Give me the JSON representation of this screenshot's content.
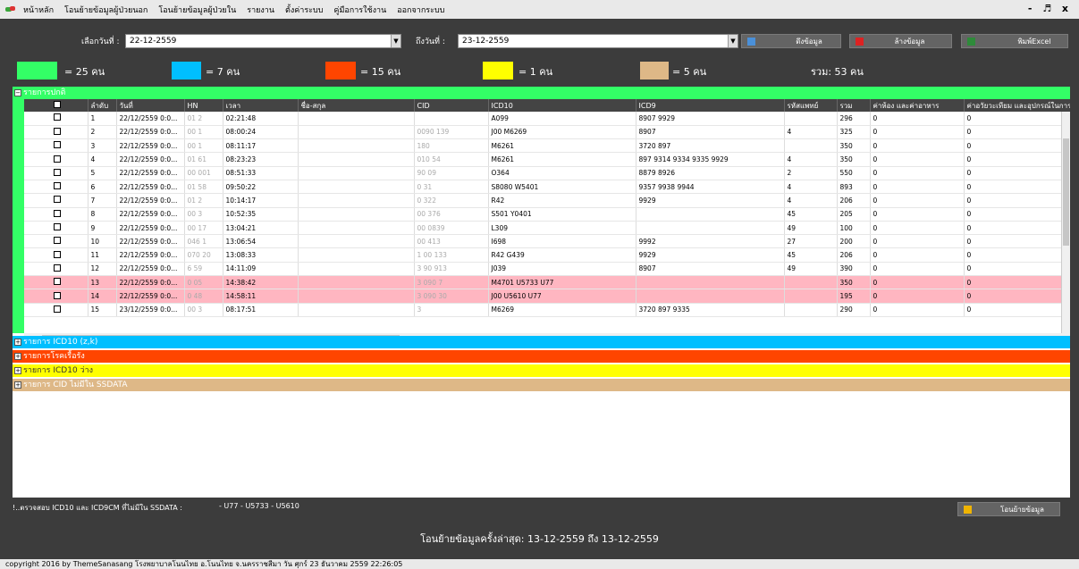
{
  "menu": {
    "items": [
      "หน้าหลัก",
      "โอนย้ายข้อมูลผู้ป่วยนอก",
      "โอนย้ายข้อมูลผู้ป่วยใน",
      "รายงาน",
      "ตั้งค่าระบบ",
      "คู่มือการใช้งาน",
      "ออกจากระบบ"
    ],
    "window_controls": "- ♬ x"
  },
  "filter": {
    "from_label": "เลือกวันที่ :",
    "from_value": "22-12-2559",
    "to_label": "ถึงวันที่ :",
    "to_value": "23-12-2559",
    "fetch_button": "ดึงข้อมูล",
    "clear_button": "ล้างข้อมูล",
    "excel_button": "พิมพ์Excel"
  },
  "legend": [
    {
      "color": "#33ff66",
      "text": "= 25 คน"
    },
    {
      "color": "#00bfff",
      "text": "= 7 คน"
    },
    {
      "color": "#ff4500",
      "text": "= 15 คน"
    },
    {
      "color": "#ffff00",
      "text": "= 1 คน"
    },
    {
      "color": "#deb887",
      "text": "= 5 คน"
    }
  ],
  "total_text": "รวม: 53 คน",
  "groups": {
    "normal": "รายการปกติ",
    "icd10_zk": "รายการ ICD10 (z,k)",
    "chronic": "รายการโรคเรื้อรัง",
    "icd10_empty": "รายการ ICD10 ว่าง",
    "cid_missing": "รายการ CID ไม่มีใน SSDATA"
  },
  "table": {
    "columns": [
      "",
      "ลำดับ",
      "วันที่",
      "HN",
      "เวลา",
      "ชื่อ-สกุล",
      "CID",
      "ICD10",
      "ICD9",
      "รหัสแพทย์",
      "รวม",
      "ค่าห้อง และค่าอาหาร",
      "ค่าอวัยวะเทียม และอุปกรณ์ในการบำบัด"
    ],
    "rows": [
      {
        "no": "1",
        "date": "22/12/2559 0:0...",
        "hn": "01 2",
        "time": "02:21:48",
        "name": "",
        "cid": "",
        "icd10": "A099",
        "icd9": "8907 9929",
        "doc": "",
        "total": "296",
        "room": "0",
        "device": "0",
        "pink": false
      },
      {
        "no": "2",
        "date": "22/12/2559 0:0...",
        "hn": "00 1",
        "time": "08:00:24",
        "name": "",
        "cid": "0090 139",
        "icd10": "J00 M6269",
        "icd9": "8907",
        "doc": "4",
        "total": "325",
        "room": "0",
        "device": "0",
        "pink": false
      },
      {
        "no": "3",
        "date": "22/12/2559 0:0...",
        "hn": "00 1",
        "time": "08:11:17",
        "name": "",
        "cid": "180",
        "icd10": "M6261",
        "icd9": "3720 897",
        "doc": "",
        "total": "350",
        "room": "0",
        "device": "0",
        "pink": false
      },
      {
        "no": "4",
        "date": "22/12/2559 0:0...",
        "hn": "01 61",
        "time": "08:23:23",
        "name": "",
        "cid": "010 54",
        "icd10": "M6261",
        "icd9": "897 9314 9334 9335 9929",
        "doc": "4",
        "total": "350",
        "room": "0",
        "device": "0",
        "pink": false
      },
      {
        "no": "5",
        "date": "22/12/2559 0:0...",
        "hn": "00 001",
        "time": "08:51:33",
        "name": "",
        "cid": "90 09",
        "icd10": "O364",
        "icd9": "8879 8926",
        "doc": "2",
        "total": "550",
        "room": "0",
        "device": "0",
        "pink": false
      },
      {
        "no": "6",
        "date": "22/12/2559 0:0...",
        "hn": "01 58",
        "time": "09:50:22",
        "name": "",
        "cid": "0 31",
        "icd10": "S8080 W5401",
        "icd9": "9357 9938 9944",
        "doc": "4",
        "total": "893",
        "room": "0",
        "device": "0",
        "pink": false
      },
      {
        "no": "7",
        "date": "22/12/2559 0:0...",
        "hn": "01 2",
        "time": "10:14:17",
        "name": "",
        "cid": "0 322",
        "icd10": "R42",
        "icd9": "9929",
        "doc": "4",
        "total": "206",
        "room": "0",
        "device": "0",
        "pink": false
      },
      {
        "no": "8",
        "date": "22/12/2559 0:0...",
        "hn": "00 3",
        "time": "10:52:35",
        "name": "",
        "cid": "00 376",
        "icd10": "S501 Y0401",
        "icd9": "",
        "doc": "45",
        "total": "205",
        "room": "0",
        "device": "0",
        "pink": false
      },
      {
        "no": "9",
        "date": "22/12/2559 0:0...",
        "hn": "00 17",
        "time": "13:04:21",
        "name": "",
        "cid": "00 0839",
        "icd10": "L309",
        "icd9": "",
        "doc": "49",
        "total": "100",
        "room": "0",
        "device": "0",
        "pink": false
      },
      {
        "no": "10",
        "date": "22/12/2559 0:0...",
        "hn": "046 1",
        "time": "13:06:54",
        "name": "",
        "cid": "00 413",
        "icd10": "I698",
        "icd9": "9992",
        "doc": "27",
        "total": "200",
        "room": "0",
        "device": "0",
        "pink": false
      },
      {
        "no": "11",
        "date": "22/12/2559 0:0...",
        "hn": "070 20",
        "time": "13:08:33",
        "name": "",
        "cid": "1 00 133",
        "icd10": "R42 G439",
        "icd9": "9929",
        "doc": "45",
        "total": "206",
        "room": "0",
        "device": "0",
        "pink": false
      },
      {
        "no": "12",
        "date": "22/12/2559 0:0...",
        "hn": "6 59",
        "time": "14:11:09",
        "name": "",
        "cid": "3 90 913",
        "icd10": "J039",
        "icd9": "8907",
        "doc": "49",
        "total": "390",
        "room": "0",
        "device": "0",
        "pink": false
      },
      {
        "no": "13",
        "date": "22/12/2559 0:0...",
        "hn": "0 05",
        "time": "14:38:42",
        "name": "",
        "cid": "3 090 7",
        "icd10": "M4701 U5733 U77",
        "icd9": "",
        "doc": "",
        "total": "350",
        "room": "0",
        "device": "0",
        "pink": true
      },
      {
        "no": "14",
        "date": "22/12/2559 0:0...",
        "hn": "0 48",
        "time": "14:58:11",
        "name": "",
        "cid": "3 090 30",
        "icd10": "J00 U5610 U77",
        "icd9": "",
        "doc": "",
        "total": "195",
        "room": "0",
        "device": "0",
        "pink": true
      },
      {
        "no": "15",
        "date": "23/12/2559 0:0...",
        "hn": "00 3",
        "time": "08:17:51",
        "name": "",
        "cid": "3",
        "icd10": "M6269",
        "icd9": "3720 897 9335",
        "doc": "",
        "total": "290",
        "room": "0",
        "device": "0",
        "pink": false
      }
    ]
  },
  "status": {
    "check_label": "!..ตรวจสอบ ICD10 และ ICD9CM ที่ไม่มีใน SSDATA :",
    "check_value": "- U77 - U5733 - U5610",
    "transfer_button": "โอนย้ายข้อมูล"
  },
  "last_transfer": "โอนย้ายข้อมูลครั้งล่าสุด: 13-12-2559 ถึง 13-12-2559",
  "footer": "copyright 2016 by ThemeSanasang   โรงพยาบาลโนนไทย อ.โนนไทย จ.นครราชสีมา   วัน ศุกร์ 23 ธันวาคม 2559 22:26:05"
}
